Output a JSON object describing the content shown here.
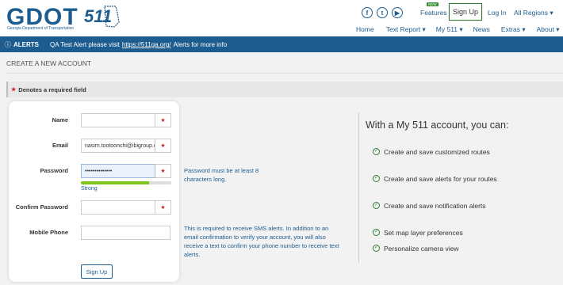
{
  "header": {
    "logo_text": "GDOT",
    "logo_subtitle": "Georgia Department of Transportation",
    "logo_511": "511",
    "social": [
      "facebook-icon",
      "twitter-icon",
      "youtube-icon"
    ],
    "new_badge": "NEW",
    "features_label": "Features",
    "signup_label": "Sign Up",
    "login_label": "Log In",
    "regions_label": "All Regions ▾",
    "nav": [
      "Home",
      "Text Report ▾",
      "My 511 ▾",
      "News",
      "Extras ▾",
      "About ▾"
    ]
  },
  "alert": {
    "label": "ALERTS",
    "text_before": "QA Test Alert please visit",
    "link": "https://511ga.org/",
    "text_after": "Alerts for more info"
  },
  "page": {
    "title": "CREATE A NEW ACCOUNT",
    "required_note": "Denotes a required field",
    "required_star": "★"
  },
  "form": {
    "name_label": "Name",
    "name_value": "",
    "email_label": "Email",
    "email_value": "nasim.tootoonchi@ibigroup.com",
    "password_label": "Password",
    "password_value": "••••••••••••••",
    "password_strength_fraction": 0.75,
    "strength_label": "Strong",
    "confirm_label": "Confirm Password",
    "confirm_value": "",
    "phone_label": "Mobile Phone",
    "phone_value": "",
    "submit_label": "Sign Up"
  },
  "hints": {
    "password": "Password must be at least 8 characters long.",
    "phone": "This is required to receive SMS alerts. In addition to an email confirmation to verify your account, you will also receive a text to confirm your phone number to receive text alerts."
  },
  "benefits": {
    "title": "With a My 511 account, you can:",
    "items": [
      "Create and save customized routes",
      "Create and save alerts for your routes",
      "Create and save notification alerts",
      "Set map layer preferences",
      "Personalize camera view"
    ]
  },
  "colors": {
    "brand_blue": "#1d5c8e",
    "required_red": "#c62828",
    "success_green": "#2e7d32",
    "strength_green": "#7cc61c"
  }
}
